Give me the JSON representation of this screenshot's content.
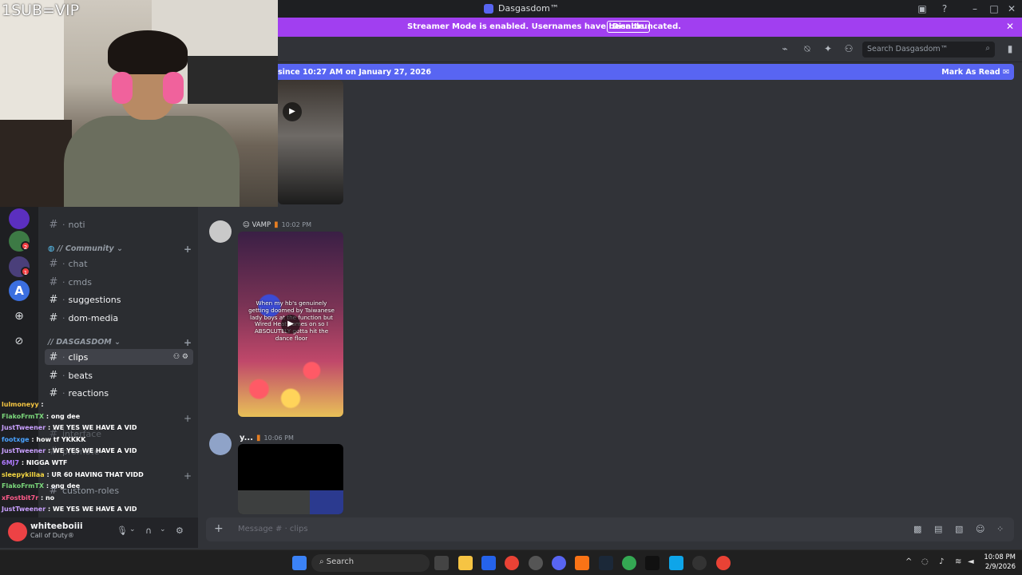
{
  "window": {
    "title": "Dasgasdom™"
  },
  "banner": {
    "message": "Streamer Mode is enabled. Usernames have been truncated.",
    "disable_label": "Disable"
  },
  "header": {
    "search_placeholder": "Search Dasgasdom™"
  },
  "new_messages": {
    "since_text": "since 10:27 AM on January 27, 2026",
    "mark_read_label": "Mark As Read"
  },
  "overlay": {
    "sub_text": "1SUB=VIP"
  },
  "servers": [
    {
      "color": "#5b2fbf"
    },
    {
      "color": "#3d7a45",
      "badge": "2"
    },
    {
      "color": "#4a3f7a",
      "badge": "1"
    },
    {
      "color": "#3b6fe0",
      "letter": "A"
    }
  ],
  "sidebar": {
    "channels_top": [
      {
        "label": "noti"
      }
    ],
    "category_community": "// Community",
    "community_channels": [
      {
        "label": "chat"
      },
      {
        "label": "cmds"
      },
      {
        "label": "suggestions",
        "unread": true
      },
      {
        "label": "dom-media",
        "unread": true
      }
    ],
    "category_dasgasdom": "// DASGASDOM",
    "dasgasdom_channels": [
      {
        "label": "clips",
        "active": true
      },
      {
        "label": "beats",
        "unread": true
      },
      {
        "label": "reactions",
        "unread": true
      }
    ],
    "hidden_channels": [
      {
        "label": "interface"
      },
      {
        "label": "promote"
      },
      {
        "label": "custom-roles"
      }
    ]
  },
  "user_panel": {
    "name": "whiteeboiii",
    "status": "Call of Duty®"
  },
  "stream_chat": [
    {
      "user": "lulmoneyy",
      "color": "#f5c542",
      "text": ":"
    },
    {
      "user": "FlakoFrmTX",
      "color": "#7bd67b",
      "text": ": ong dee"
    },
    {
      "user": "JustTweener",
      "color": "#c9a0ff",
      "text": ": WE YES WE HAVE A VID"
    },
    {
      "user": "footxge",
      "color": "#4aa3ff",
      "text": ": how tf YKKKK"
    },
    {
      "user": "JustTweener",
      "color": "#c9a0ff",
      "text": ": WE YES WE HAVE A VID"
    },
    {
      "user": "6MJ7",
      "color": "#b07aff",
      "text": ": NIGGA WTF"
    },
    {
      "user": "sleepykillaa",
      "color": "#f5d742",
      "text": ": UR 60 HAVING THAT VIDD"
    },
    {
      "user": "FlakoFrmTX",
      "color": "#7bd67b",
      "text": ": ong dee"
    },
    {
      "user": "xFostbit7r",
      "color": "#ff5b8a",
      "text": ": no"
    },
    {
      "user": "JustTweener",
      "color": "#c9a0ff",
      "text": ": WE YES WE HAVE A VID"
    },
    {
      "user": "6MJ7",
      "color": "#b07aff",
      "text": ""
    },
    {
      "user": "6MJ7",
      "color": "#b07aff",
      "text": ""
    }
  ],
  "messages": [
    {
      "author": "",
      "tag": "VAMP",
      "time": "10:02 PM",
      "caption": "When my hb's genuinely getting doomed by Taiwanese lady boys at the function but Wired Heat comes on so I ABSOLUTELY gotta hit the dance floor"
    },
    {
      "author": "y...",
      "time": "10:06 PM"
    }
  ],
  "composer": {
    "placeholder": "Message # · clips"
  },
  "taskbar": {
    "search_label": "Search",
    "time": "10:08 PM",
    "date": "2/9/2026"
  }
}
